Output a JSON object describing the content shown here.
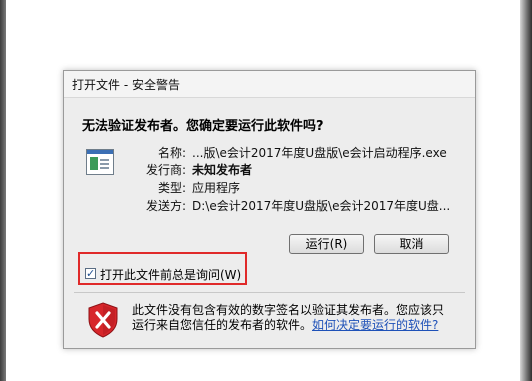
{
  "dialog": {
    "title": "打开文件 - 安全警告",
    "headline": "无法验证发布者。您确定要运行此软件吗?",
    "details": [
      {
        "label": "名称:",
        "value": "...版\\e会计2017年度U盘版\\e会计启动程序.exe",
        "bold": false
      },
      {
        "label": "发行商:",
        "value": "未知发布者",
        "bold": true
      },
      {
        "label": "类型:",
        "value": "应用程序",
        "bold": false
      },
      {
        "label": "发送方:",
        "value": "D:\\e会计2017年度U盘版\\e会计2017年度U盘...",
        "bold": false
      }
    ],
    "buttons": {
      "run": "运行(R)",
      "cancel": "取消"
    },
    "checkbox": {
      "label": "打开此文件前总是询问(W)",
      "checked": true,
      "mark": "✓"
    },
    "warning": {
      "line1": "此文件没有包含有效的数字签名以验证其发布者。您应该只",
      "line2_prefix": "运行来自您信任的发布者的软件。",
      "link": "如何决定要运行的软件?"
    }
  },
  "colors": {
    "highlight_frame": "#e02a2a",
    "link": "#1e51b8",
    "shield": "#d7262b"
  }
}
